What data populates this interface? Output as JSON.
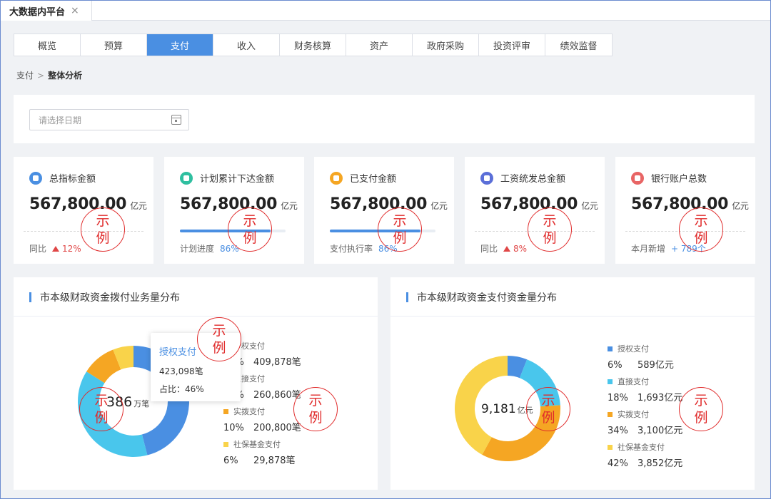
{
  "page_tab": {
    "label": "大数据内平台",
    "close": "×"
  },
  "nav": {
    "tabs": [
      "概览",
      "预算",
      "支付",
      "收入",
      "财务核算",
      "资产",
      "政府采购",
      "投资评审",
      "绩效监督"
    ],
    "active": "支付"
  },
  "breadcrumb": {
    "parent": "支付",
    "sep": ">",
    "current": "整体分析"
  },
  "filter": {
    "date_placeholder": "请选择日期"
  },
  "cards": [
    {
      "title": "总指标金额",
      "value": "567,800.00",
      "unit": "亿元",
      "foot_label": "同比",
      "foot_value": "12%",
      "trend": "up",
      "icon": "coins-icon",
      "icon_color": "#4a8fe2"
    },
    {
      "title": "计划累计下达金额",
      "value": "567,800.00",
      "unit": "亿元",
      "foot_label": "计划进度",
      "foot_value": "86%",
      "progress": 0.86,
      "icon": "plan-icon",
      "icon_color": "#2fbfa0"
    },
    {
      "title": "已支付金额",
      "value": "567,800.00",
      "unit": "亿元",
      "foot_label": "支付执行率",
      "foot_value": "86%",
      "progress": 0.86,
      "icon": "wallet-icon",
      "icon_color": "#f5a623"
    },
    {
      "title": "工资统发总金额",
      "value": "567,800.00",
      "unit": "亿元",
      "foot_label": "同比",
      "foot_value": "8%",
      "trend": "up",
      "icon": "salary-icon",
      "icon_color": "#5b6fd8"
    },
    {
      "title": "银行账户总数",
      "value": "567,800.00",
      "unit": "亿元",
      "foot_label": "本月新增",
      "foot_value": "+ 789个",
      "icon": "bank-card-icon",
      "icon_color": "#e86565"
    }
  ],
  "stamp_text": [
    "示",
    "例"
  ],
  "chart_left": {
    "title": "市本级财政资金拨付业务量分布",
    "center_value": "386",
    "center_unit": "万笔",
    "tooltip": {
      "title": "授权支付",
      "count": "423,098笔",
      "ratio": "占比：46%"
    },
    "legend": [
      {
        "name": "授权支付",
        "pct": "46%",
        "amount": "409,878笔",
        "color": "#4a8fe2"
      },
      {
        "name": "直接支付",
        "pct": "38%",
        "amount": "260,860笔",
        "color": "#49c6ec"
      },
      {
        "name": "实拨支付",
        "pct": "10%",
        "amount": "200,800笔",
        "color": "#f5a623"
      },
      {
        "name": "社保基金支付",
        "pct": "6%",
        "amount": "29,878笔",
        "color": "#f9d34a"
      }
    ]
  },
  "chart_right": {
    "title": "市本级财政资金支付资金量分布",
    "center_value": "9,181",
    "center_unit": "亿元",
    "legend": [
      {
        "name": "授权支付",
        "pct": "6%",
        "amount": "589亿元",
        "color": "#4a8fe2"
      },
      {
        "name": "直接支付",
        "pct": "18%",
        "amount": "1,693亿元",
        "color": "#49c6ec"
      },
      {
        "name": "实拨支付",
        "pct": "34%",
        "amount": "3,100亿元",
        "color": "#f5a623"
      },
      {
        "name": "社保基金支付",
        "pct": "42%",
        "amount": "3,852亿元",
        "color": "#f9d34a"
      }
    ]
  },
  "chart_data": [
    {
      "type": "pie",
      "title": "市本级财政资金拨付业务量分布",
      "categories": [
        "授权支付",
        "直接支付",
        "实拨支付",
        "社保基金支付"
      ],
      "values": [
        46,
        38,
        10,
        6
      ],
      "counts": [
        409878,
        260860,
        200800,
        29878
      ],
      "colors": [
        "#4a8fe2",
        "#49c6ec",
        "#f5a623",
        "#f9d34a"
      ]
    },
    {
      "type": "pie",
      "title": "市本级财政资金支付资金量分布",
      "categories": [
        "授权支付",
        "直接支付",
        "实拨支付",
        "社保基金支付"
      ],
      "values": [
        6,
        18,
        34,
        42
      ],
      "amounts": [
        589,
        1693,
        3100,
        3852
      ],
      "colors": [
        "#4a8fe2",
        "#49c6ec",
        "#f5a623",
        "#f9d34a"
      ]
    }
  ]
}
